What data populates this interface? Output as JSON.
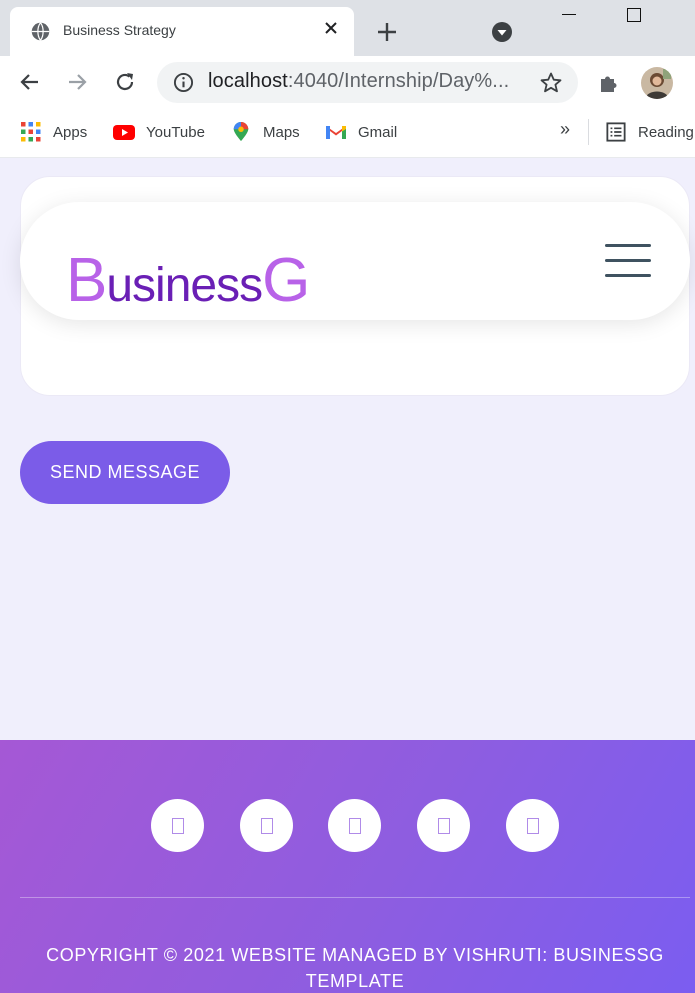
{
  "browser": {
    "tab_title": "Business Strategy",
    "url_host": "localhost",
    "url_rest": ":4040/Internship/Day%...",
    "bookmarks": [
      {
        "label": "Apps",
        "icon": "apps-grid-icon"
      },
      {
        "label": "YouTube",
        "icon": "youtube-icon"
      },
      {
        "label": "Maps",
        "icon": "maps-pin-icon"
      },
      {
        "label": "Gmail",
        "icon": "gmail-icon"
      }
    ],
    "overflow_label": "»",
    "reading_list_label": "Reading"
  },
  "site": {
    "logo_first": "B",
    "logo_middle": "usiness",
    "logo_last": "G",
    "send_button_label": "SEND MESSAGE",
    "social_icons": [
      "social-icon-1",
      "social-icon-2",
      "social-icon-3",
      "social-icon-4",
      "social-icon-5"
    ],
    "copyright": "COPYRIGHT © 2021 WEBSITE MANAGED BY VISHRUTI: BUSINESSG TEMPLATE"
  },
  "colors": {
    "accent": "#7b5ce8",
    "logo_light": "#b862e8",
    "logo_dark": "#6a1fb5",
    "page_bg": "#f0effc",
    "footer_start": "#a558d5",
    "footer_end": "#7b5df0"
  }
}
